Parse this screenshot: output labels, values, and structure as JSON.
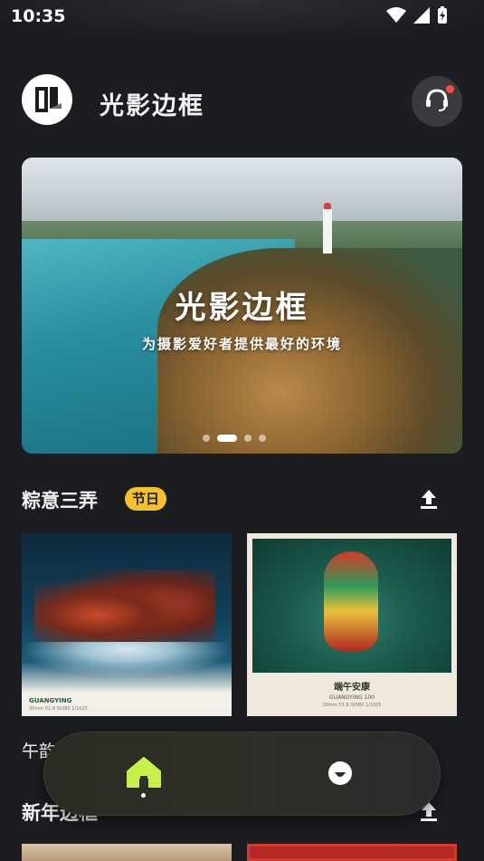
{
  "status_bar": {
    "time": "10:35",
    "icons": [
      "wifi-icon",
      "signal-icon",
      "battery-charging-icon"
    ]
  },
  "header": {
    "app_title": "光影边框",
    "logo_icon": "app-logo-icon",
    "support_icon": "headset-support-icon",
    "support_badge_color": "#ff4a3d"
  },
  "banner": {
    "title": "光影边框",
    "subtitle": "为摄影爱好者提供最好的环境",
    "slide_count": 4,
    "active_slide": 2
  },
  "sections": [
    {
      "title": "粽意三弄",
      "tag": "节日",
      "upload_icon": "upload-icon",
      "cards": [
        {
          "label": "午韵",
          "brand": "GUANGYING",
          "meta": "30mm f/1.8 ISO80 1/1025"
        },
        {
          "caption_title": "端午安康",
          "brand": "GUANGYING 100",
          "meta": "30mm f/1.8 ISO80 1/1025"
        }
      ]
    },
    {
      "title": "新年边框",
      "tag": "",
      "upload_icon": "upload-icon"
    }
  ],
  "bottom_nav": {
    "items": [
      {
        "name": "home",
        "icon": "home-icon",
        "active": true,
        "color": "#c6f04a"
      },
      {
        "name": "profile",
        "icon": "profile-icon",
        "active": false,
        "color": "#ffffff"
      }
    ]
  },
  "colors": {
    "background": "#1c1d21",
    "tag": "#f6c22b",
    "accent": "#c6f04a"
  }
}
